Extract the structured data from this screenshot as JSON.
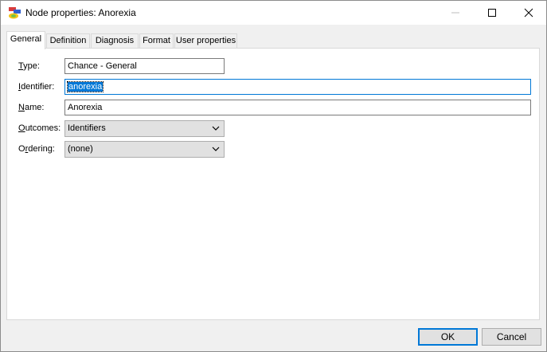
{
  "window": {
    "title": "Node properties: Anorexia"
  },
  "titlebar_buttons": {
    "minimize_icon": "minimize-icon",
    "maximize_icon": "maximize-icon",
    "close_icon": "close-icon"
  },
  "tabs": [
    {
      "label": "General",
      "active": true
    },
    {
      "label": "Definition",
      "active": false
    },
    {
      "label": "Diagnosis",
      "active": false
    },
    {
      "label": "Format",
      "active": false
    },
    {
      "label": "User properties",
      "active": false
    }
  ],
  "form": {
    "type": {
      "label": "Type:",
      "value": "Chance - General"
    },
    "identifier": {
      "label": "Identifier:",
      "value": "anorexia"
    },
    "name": {
      "label": "Name:",
      "value": "Anorexia"
    },
    "outcomes": {
      "label": "Outcomes:",
      "value": "Identifiers"
    },
    "ordering": {
      "label": "Ordering:",
      "value": "(none)"
    }
  },
  "buttons": {
    "ok": "OK",
    "cancel": "Cancel"
  },
  "colors": {
    "accent": "#0078d7",
    "selection_text": "#ffffff"
  }
}
